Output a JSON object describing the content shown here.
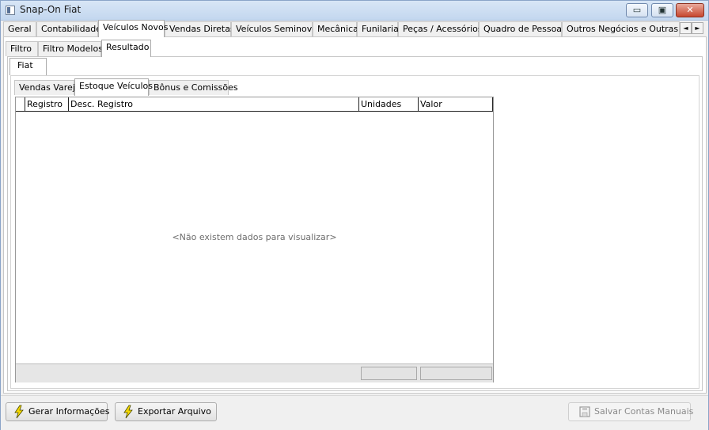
{
  "window": {
    "title": "Snap-On Fiat"
  },
  "titlebar_buttons": {
    "minimize": "▭",
    "maximize": "▣",
    "close": "✕"
  },
  "main_tabs": [
    "Geral",
    "Contabilidade",
    "Veículos Novos",
    "Vendas Diretas",
    "Veículos Seminovos",
    "Mecânica",
    "Funilaria",
    "Peças / Acessórios",
    "Quadro de Pessoas",
    "Outros Negócios e Outras Mar"
  ],
  "main_tabs_active": "Veículos Novos",
  "tab_scroll": {
    "left": "◄",
    "right": "►"
  },
  "sub_tabs": [
    "Filtro",
    "Filtro Modelos",
    "Resultado"
  ],
  "sub_tabs_active": "Resultado",
  "brand_tabs": [
    "Fiat"
  ],
  "report_tabs": [
    "Vendas Varejo",
    "Estoque Veículos",
    "Bônus e Comissões"
  ],
  "report_tabs_active": "Estoque Veículos",
  "grid": {
    "columns": [
      "Registro",
      "Desc. Registro",
      "Unidades",
      "Valor"
    ],
    "empty_message": "<Não existem dados para visualizar>"
  },
  "buttons": {
    "generate": "Gerar Informações",
    "export": "Exportar Arquivo",
    "save_manual": "Salvar Contas Manuais"
  },
  "icons": {
    "generate": "lightning-icon",
    "export": "lightning-icon",
    "save_manual": "save-icon"
  },
  "colors": {
    "lightning": "#f5d800",
    "titlebar": "#c9dcf2",
    "close_button": "#c7472f"
  }
}
